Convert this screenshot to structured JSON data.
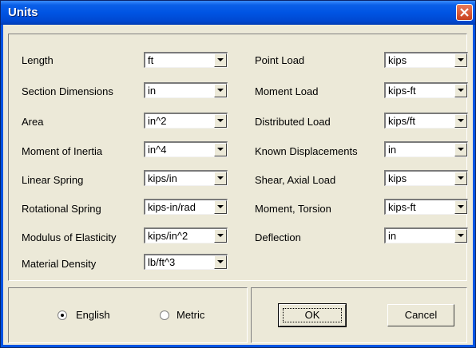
{
  "window": {
    "title": "Units"
  },
  "left_fields": [
    {
      "label": "Length",
      "value": "ft"
    },
    {
      "label": "Section Dimensions",
      "value": "in"
    },
    {
      "label": "Area",
      "value": "in^2"
    },
    {
      "label": "Moment of Inertia",
      "value": "in^4"
    },
    {
      "label": "Linear Spring",
      "value": "kips/in"
    },
    {
      "label": "Rotational Spring",
      "value": "kips-in/rad"
    },
    {
      "label": "Modulus of Elasticity",
      "value": "kips/in^2"
    },
    {
      "label": "Material Density",
      "value": "lb/ft^3"
    }
  ],
  "right_fields": [
    {
      "label": "Point Load",
      "value": "kips"
    },
    {
      "label": "Moment Load",
      "value": "kips-ft"
    },
    {
      "label": "Distributed Load",
      "value": "kips/ft"
    },
    {
      "label": "Known Displacements",
      "value": "in"
    },
    {
      "label": "Shear, Axial Load",
      "value": "kips"
    },
    {
      "label": "Moment, Torsion",
      "value": "kips-ft"
    },
    {
      "label": "Deflection",
      "value": "in"
    }
  ],
  "unit_system": {
    "english_label": "English",
    "metric_label": "Metric",
    "selected": "English"
  },
  "buttons": {
    "ok": "OK",
    "cancel": "Cancel"
  },
  "colors": {
    "titlebar": "#0054e3",
    "close": "#d9532b",
    "face": "#ece9d8"
  }
}
